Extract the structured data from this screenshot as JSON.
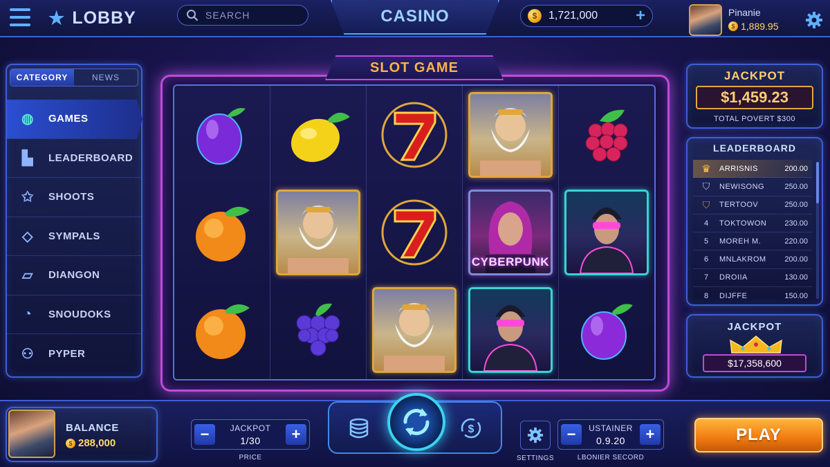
{
  "topbar": {
    "lobby_label": "LOBBY",
    "search_placeholder": "SEARCH",
    "title": "CASINO",
    "coins": "1,721,000",
    "player_name": "Pinanie",
    "player_balance": "1,889.95"
  },
  "sidebar": {
    "tabs": [
      {
        "label": "CATEGORY",
        "active": true
      },
      {
        "label": "NEWS",
        "active": false
      }
    ],
    "items": [
      {
        "label": "GAMES",
        "icon": "globe-icon",
        "active": true
      },
      {
        "label": "LEADERBOARD",
        "icon": "podium-icon",
        "active": false
      },
      {
        "label": "SHOOTS",
        "icon": "star-icon",
        "active": false
      },
      {
        "label": "SYMPALS",
        "icon": "diamond-icon",
        "active": false
      },
      {
        "label": "DIANGON",
        "icon": "cards-icon",
        "active": false
      },
      {
        "label": "SNOUDOKS",
        "icon": "stopwatch-icon",
        "active": false
      },
      {
        "label": "PYPER",
        "icon": "people-icon",
        "active": false
      }
    ]
  },
  "slot": {
    "title": "SLOT GAME",
    "reels": [
      [
        "plum",
        "peach",
        "peach"
      ],
      [
        "lemon",
        "zeus",
        "grapes"
      ],
      [
        "seven",
        "seven",
        "zeus"
      ],
      [
        "zeus",
        "cyberpunk-woman",
        "cyberpunk-man"
      ],
      [
        "raspberry",
        "cyberpunk-man",
        "plum"
      ]
    ],
    "cyberpunk_label": "CYBERPUNK"
  },
  "jackpot_top": {
    "title": "JACKPOT",
    "value": "$1,459.23",
    "subtitle": "TOTAL POVERT $300"
  },
  "leaderboard": {
    "title": "LEADERBOARD",
    "rows": [
      {
        "rank": "1",
        "badge": "gold-crown",
        "name": "ARRISNIS",
        "score": "200.00"
      },
      {
        "rank": "2",
        "badge": "silver-shield",
        "name": "NEWISONG",
        "score": "250.00"
      },
      {
        "rank": "3",
        "badge": "bronze-shield",
        "name": "TERTOOV",
        "score": "250.00"
      },
      {
        "rank": "4",
        "name": "TOKTOWON",
        "score": "230.00"
      },
      {
        "rank": "5",
        "name": "MOREH M.",
        "score": "220.00"
      },
      {
        "rank": "6",
        "name": "MNLAKROM",
        "score": "200.00"
      },
      {
        "rank": "7",
        "name": "DROIIA",
        "score": "130.00"
      },
      {
        "rank": "8",
        "name": "DIJFFE",
        "score": "150.00"
      }
    ]
  },
  "jackpot_bottom": {
    "title": "JACKPOT",
    "value": "$17,358,600"
  },
  "bottombar": {
    "balance_label": "BALANCE",
    "balance_value": "288,000",
    "stepper1": {
      "label": "JACKPOT",
      "value": "1/30",
      "caption": "PRICE"
    },
    "settings_caption": "SETTINGS",
    "stepper2": {
      "label": "USTAINER",
      "value": "0.9.20",
      "caption": "LBONIER SECORD"
    },
    "play_label": "PLAY"
  },
  "colors": {
    "accent": "#3e5fd6",
    "neon_pink": "#c04bd8",
    "gold": "#ffcf70",
    "play": "#f07a12"
  }
}
